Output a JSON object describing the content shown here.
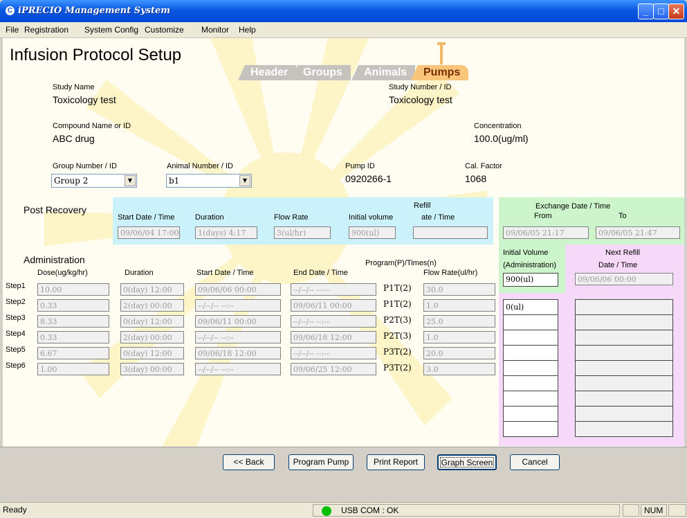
{
  "window": {
    "title": "iPRECIO Management System",
    "app_icon": "C"
  },
  "menu": [
    "File",
    "Registration",
    "System Config",
    "Customize",
    "Monitor",
    "Help"
  ],
  "page": {
    "title": "Infusion Protocol Setup"
  },
  "tabs": [
    "Header",
    "Groups",
    "Animals",
    "Pumps"
  ],
  "study": {
    "name_label": "Study Name",
    "name": "Toxicology test",
    "number_label": "Study Number / ID",
    "number": "Toxicology test",
    "compound_label": "Compound Name or ID",
    "compound": "ABC drug",
    "concentration_label": "Concentration",
    "concentration": "100.0(ug/ml)",
    "group_label": "Group Number / ID",
    "group": "Group 2",
    "animal_label": "Animal Number / ID",
    "animal": "b1",
    "pump_label": "Pump ID",
    "pump": "0920266-1",
    "calfactor_label": "Cal. Factor",
    "calfactor": "1068"
  },
  "post_recovery": {
    "label": "Post Recovery",
    "start_label": "Start Date / Time",
    "start": "09/06/04 17:00",
    "duration_label": "Duration",
    "duration": "1(days) 4:17",
    "flow_label": "Flow Rate",
    "flow": "3(ul/hr)",
    "initvol_label": "Initial volume",
    "initvol": "900(ul)",
    "refill_label_1": "Refill",
    "refill_label_2": "ate / Time",
    "refill": ""
  },
  "exchange": {
    "label": "Exchange Date / Time",
    "from_label": "From",
    "to_label": "To",
    "from": "09/06/05 21:17",
    "to": "09/06/05 21:47"
  },
  "initial_volume": {
    "label_1": "Initial Volume",
    "label_2": "(Administration)",
    "value": "900(ul)"
  },
  "next_refill": {
    "label_1": "Next Refill",
    "label_2": "Date / Time",
    "value": "09/06/06 00:00"
  },
  "administration": {
    "label": "Administration",
    "headers": {
      "dose": "Dose(ug/kg/hr)",
      "duration": "Duration",
      "start": "Start Date / Time",
      "end": "End Date / Time",
      "program": "Program(P)/Times(n)",
      "flow": "Flow Rate(ul/hr)"
    },
    "steps": [
      {
        "label": "Step1",
        "dose": "10.00",
        "duration": "0(day) 12:00",
        "start": "09/06/06 00:00",
        "end": "--/--/-- --:--",
        "program": "P1T(2)",
        "flow": "30.0"
      },
      {
        "label": "Step2",
        "dose": "0.33",
        "duration": "2(day) 00:00",
        "start": "--/--/-- --:--",
        "end": "09/06/11 00:00",
        "program": "P1T(2)",
        "flow": "1.0"
      },
      {
        "label": "Step3",
        "dose": "8.33",
        "duration": "0(day) 12:00",
        "start": "09/06/11 00:00",
        "end": "--/--/-- --:--",
        "program": "P2T(3)",
        "flow": "25.0"
      },
      {
        "label": "Step4",
        "dose": "0.33",
        "duration": "2(day) 00:00",
        "start": "--/--/-- --:--",
        "end": "09/06/18 12:00",
        "program": "P2T(3)",
        "flow": "1.0"
      },
      {
        "label": "Step5",
        "dose": "6.67",
        "duration": "0(day) 12:00",
        "start": "09/06/18 12:00",
        "end": "--/--/-- --:--",
        "program": "P3T(2)",
        "flow": "20.0"
      },
      {
        "label": "Step6",
        "dose": "1.00",
        "duration": "3(day) 00:00",
        "start": "--/--/-- --:--",
        "end": "09/06/25 12:00",
        "program": "P3T(2)",
        "flow": "3.0"
      }
    ]
  },
  "volume_list": [
    "0(ul)",
    "",
    "",
    "",
    "",
    "",
    "",
    "",
    "",
    ""
  ],
  "refill_list": [
    "",
    "",
    "",
    "",
    "",
    "",
    "",
    "",
    "",
    ""
  ],
  "buttons": {
    "back": "<< Back",
    "program": "Program Pump",
    "print": "Print Report",
    "graph": "Graph Screen",
    "cancel": "Cancel"
  },
  "status": {
    "text": "Ready",
    "usb": "USB COM : OK",
    "num": "NUM"
  },
  "colors": {
    "post_recovery_panel": "#cbf2fa",
    "exchange_panel": "#cdf5cb",
    "refill_panel": "#f6d8f8",
    "active_tab": "#f8c57a",
    "usb_ok": "#00c000"
  }
}
